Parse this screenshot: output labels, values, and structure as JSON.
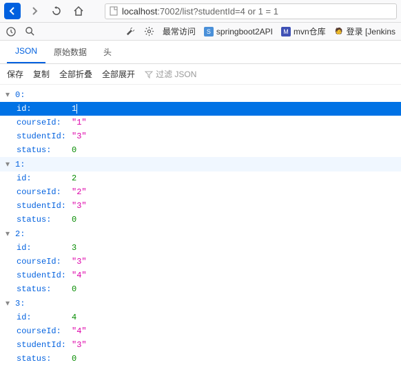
{
  "url": {
    "prefix": "localhost",
    "rest": ":7002/list?studentId=4 or 1 = 1"
  },
  "bookmarks": {
    "frequent": "最常访问",
    "b1": "springboot2API",
    "b2": "mvn仓库",
    "b3": "登录 [Jenkins"
  },
  "tabs": {
    "json": "JSON",
    "raw": "原始数据",
    "headers": "头"
  },
  "actions": {
    "save": "保存",
    "copy": "复制",
    "collapse": "全部折叠",
    "expand": "全部展开",
    "filter": "过滤 JSON"
  },
  "items": [
    {
      "idx": "0:",
      "id": 1,
      "courseId": "\"1\"",
      "studentId": "\"3\"",
      "status": 0
    },
    {
      "idx": "1:",
      "id": 2,
      "courseId": "\"2\"",
      "studentId": "\"3\"",
      "status": 0
    },
    {
      "idx": "2:",
      "id": 3,
      "courseId": "\"3\"",
      "studentId": "\"4\"",
      "status": 0
    },
    {
      "idx": "3:",
      "id": 4,
      "courseId": "\"4\"",
      "studentId": "\"3\"",
      "status": 0
    }
  ],
  "keys": {
    "id": "id:",
    "courseId": "courseId:",
    "studentId": "studentId:",
    "status": "status:"
  }
}
